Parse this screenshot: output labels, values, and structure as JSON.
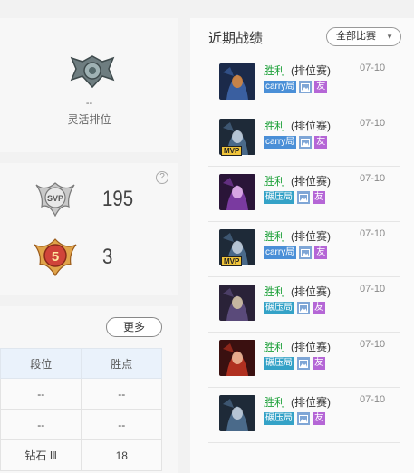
{
  "flex": {
    "tier": "--",
    "mode": "灵活排位"
  },
  "honor": {
    "help": "?",
    "svp_count": "195",
    "level": "3"
  },
  "seasons": {
    "more_label": "更多",
    "headers": [
      "段位",
      "胜点"
    ],
    "rows": [
      [
        "--",
        "--"
      ],
      [
        "--",
        "--"
      ],
      [
        "钻石 Ⅲ",
        "18"
      ]
    ]
  },
  "recent": {
    "title": "近期战绩",
    "filter_label": "全部比赛",
    "matches": [
      {
        "result": "胜利",
        "mode": "(排位赛)",
        "date": "07-10",
        "type_tag": "carry局",
        "mvp": false,
        "friend": "友",
        "champion_icon": "champion-dark-icon"
      },
      {
        "result": "胜利",
        "mode": "(排位赛)",
        "date": "07-10",
        "type_tag": "carry局",
        "mvp": true,
        "mvp_label": "MVP",
        "friend": "友",
        "champion_icon": "champion-hooded-icon"
      },
      {
        "result": "胜利",
        "mode": "(排位赛)",
        "date": "07-10",
        "type_tag": "碾压局",
        "mvp": false,
        "friend": "友",
        "champion_icon": "champion-purple-icon"
      },
      {
        "result": "胜利",
        "mode": "(排位赛)",
        "date": "07-10",
        "type_tag": "carry局",
        "mvp": true,
        "mvp_label": "MVP",
        "friend": "友",
        "champion_icon": "champion-hooded-icon"
      },
      {
        "result": "胜利",
        "mode": "(排位赛)",
        "date": "07-10",
        "type_tag": "碾压局",
        "mvp": false,
        "friend": "友",
        "champion_icon": "champion-armored-icon"
      },
      {
        "result": "胜利",
        "mode": "(排位赛)",
        "date": "07-10",
        "type_tag": "碾压局",
        "mvp": false,
        "friend": "友",
        "champion_icon": "champion-red-icon"
      },
      {
        "result": "胜利",
        "mode": "(排位赛)",
        "date": "07-10",
        "type_tag": "碾压局",
        "mvp": false,
        "friend": "友",
        "champion_icon": "champion-hooded-icon"
      }
    ]
  },
  "colors": {
    "win": "#1ea13a",
    "carry_tag": "#4a8fd7",
    "crush_tag": "#34a2c7",
    "friend_tag": "#b566d6"
  }
}
